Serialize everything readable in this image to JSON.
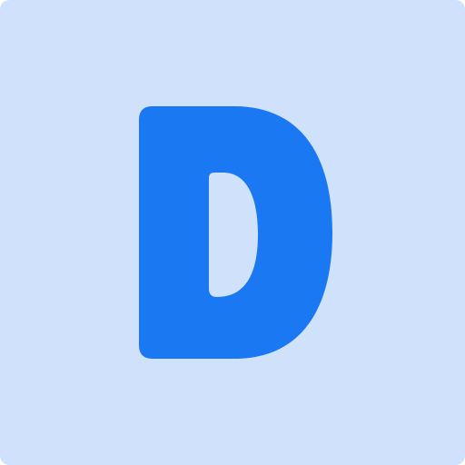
{
  "icon": {
    "name": "letter-d-icon",
    "letter": "D",
    "colors": {
      "background": "#D0E2FB",
      "glyph": "#1A78F2"
    }
  }
}
